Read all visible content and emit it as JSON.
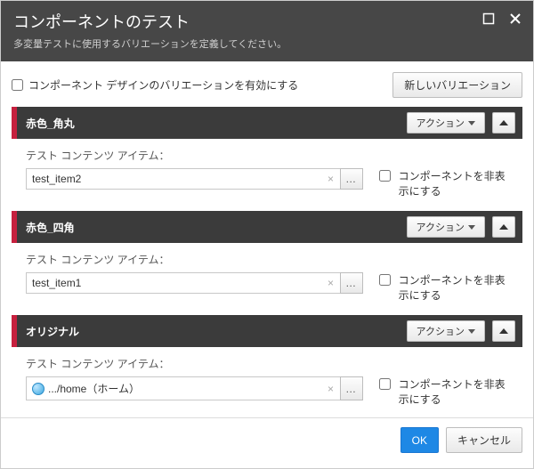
{
  "header": {
    "title": "コンポーネントのテスト",
    "subtitle": "多変量テストに使用するバリエーションを定義してください。"
  },
  "topbar": {
    "enable_variation_label": "コンポーネント デザインのバリエーションを有効にする",
    "new_variation_label": "新しいバリエーション"
  },
  "action_label": "アクション",
  "content_item_label": "テスト コンテンツ アイテム：",
  "hide_label": "コンポーネントを非表示にする",
  "sections": [
    {
      "title": "赤色_角丸",
      "item_value": "test_item2",
      "has_icon": false
    },
    {
      "title": "赤色_四角",
      "item_value": "test_item1",
      "has_icon": false
    },
    {
      "title": "オリジナル",
      "item_value": ".../home（ホーム）",
      "has_icon": true
    }
  ],
  "footer": {
    "ok": "OK",
    "cancel": "キャンセル"
  }
}
